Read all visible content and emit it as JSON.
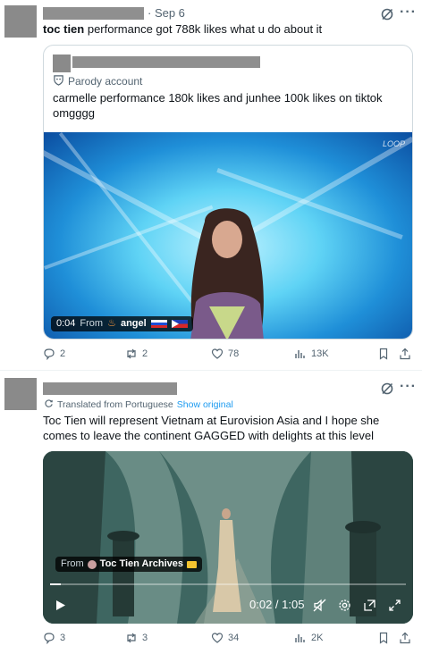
{
  "tweets": [
    {
      "date": "· Sep 6",
      "author_line": "toc tien",
      "text_rest": " performance got 788k likes what u do about it",
      "quote": {
        "badge": "Parody account",
        "text": "carmelle performance 180k likes and junhee 100k likes on tiktok omgggg",
        "media_watermark": "LOOP",
        "video_time": "0:04",
        "video_from_label": "From",
        "video_from_user": "angel"
      },
      "actions": {
        "replies": "2",
        "reposts": "2",
        "likes": "78",
        "views": "13K"
      }
    },
    {
      "translated_label": "Translated from Portuguese",
      "show_original": "Show original",
      "text": "Toc Tien will represent Vietnam at Eurovision Asia and I hope she comes to leave the continent GAGGED with delights at this level",
      "video": {
        "from_label": "From",
        "from_user": "Toc Tien Archives",
        "time": "0:02 / 1:05",
        "progress": 0.03
      },
      "actions": {
        "replies": "3",
        "reposts": "3",
        "likes": "34",
        "views": "2K"
      }
    }
  ],
  "colors": {
    "text": "#0f1419",
    "muted": "#536471",
    "link": "#1d9bf0",
    "border": "#cfd9de",
    "redaction": "#8f8f8f"
  },
  "icons": [
    "grok-icon",
    "more-icon",
    "parody-icon",
    "reply-icon",
    "repost-icon",
    "like-icon",
    "views-icon",
    "bookmark-icon",
    "share-icon",
    "translate-icon",
    "play-icon",
    "mute-icon",
    "settings-icon",
    "pip-icon",
    "fullscreen-icon"
  ]
}
